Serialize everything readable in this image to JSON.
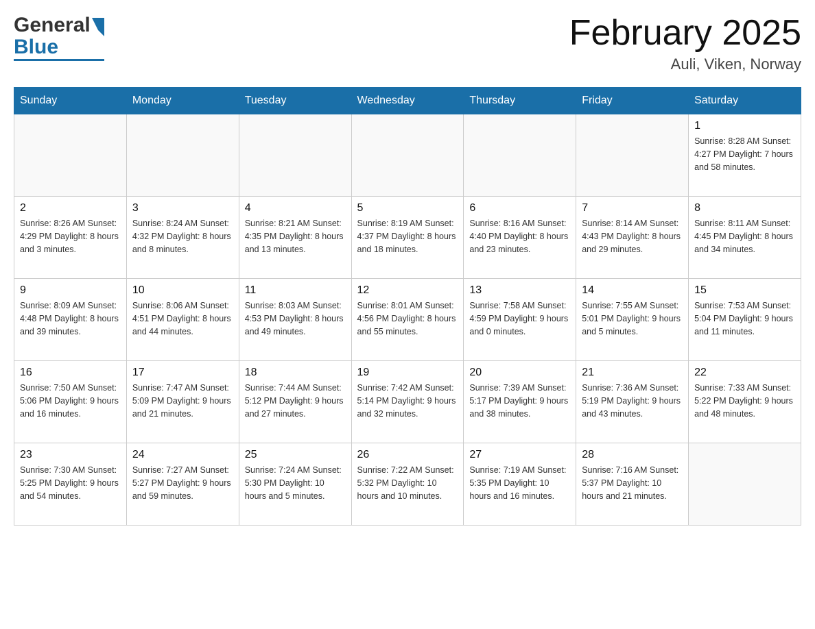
{
  "header": {
    "title": "February 2025",
    "subtitle": "Auli, Viken, Norway",
    "logo_general": "General",
    "logo_blue": "Blue"
  },
  "weekdays": [
    "Sunday",
    "Monday",
    "Tuesday",
    "Wednesday",
    "Thursday",
    "Friday",
    "Saturday"
  ],
  "weeks": [
    [
      {
        "day": "",
        "info": ""
      },
      {
        "day": "",
        "info": ""
      },
      {
        "day": "",
        "info": ""
      },
      {
        "day": "",
        "info": ""
      },
      {
        "day": "",
        "info": ""
      },
      {
        "day": "",
        "info": ""
      },
      {
        "day": "1",
        "info": "Sunrise: 8:28 AM\nSunset: 4:27 PM\nDaylight: 7 hours\nand 58 minutes."
      }
    ],
    [
      {
        "day": "2",
        "info": "Sunrise: 8:26 AM\nSunset: 4:29 PM\nDaylight: 8 hours\nand 3 minutes."
      },
      {
        "day": "3",
        "info": "Sunrise: 8:24 AM\nSunset: 4:32 PM\nDaylight: 8 hours\nand 8 minutes."
      },
      {
        "day": "4",
        "info": "Sunrise: 8:21 AM\nSunset: 4:35 PM\nDaylight: 8 hours\nand 13 minutes."
      },
      {
        "day": "5",
        "info": "Sunrise: 8:19 AM\nSunset: 4:37 PM\nDaylight: 8 hours\nand 18 minutes."
      },
      {
        "day": "6",
        "info": "Sunrise: 8:16 AM\nSunset: 4:40 PM\nDaylight: 8 hours\nand 23 minutes."
      },
      {
        "day": "7",
        "info": "Sunrise: 8:14 AM\nSunset: 4:43 PM\nDaylight: 8 hours\nand 29 minutes."
      },
      {
        "day": "8",
        "info": "Sunrise: 8:11 AM\nSunset: 4:45 PM\nDaylight: 8 hours\nand 34 minutes."
      }
    ],
    [
      {
        "day": "9",
        "info": "Sunrise: 8:09 AM\nSunset: 4:48 PM\nDaylight: 8 hours\nand 39 minutes."
      },
      {
        "day": "10",
        "info": "Sunrise: 8:06 AM\nSunset: 4:51 PM\nDaylight: 8 hours\nand 44 minutes."
      },
      {
        "day": "11",
        "info": "Sunrise: 8:03 AM\nSunset: 4:53 PM\nDaylight: 8 hours\nand 49 minutes."
      },
      {
        "day": "12",
        "info": "Sunrise: 8:01 AM\nSunset: 4:56 PM\nDaylight: 8 hours\nand 55 minutes."
      },
      {
        "day": "13",
        "info": "Sunrise: 7:58 AM\nSunset: 4:59 PM\nDaylight: 9 hours\nand 0 minutes."
      },
      {
        "day": "14",
        "info": "Sunrise: 7:55 AM\nSunset: 5:01 PM\nDaylight: 9 hours\nand 5 minutes."
      },
      {
        "day": "15",
        "info": "Sunrise: 7:53 AM\nSunset: 5:04 PM\nDaylight: 9 hours\nand 11 minutes."
      }
    ],
    [
      {
        "day": "16",
        "info": "Sunrise: 7:50 AM\nSunset: 5:06 PM\nDaylight: 9 hours\nand 16 minutes."
      },
      {
        "day": "17",
        "info": "Sunrise: 7:47 AM\nSunset: 5:09 PM\nDaylight: 9 hours\nand 21 minutes."
      },
      {
        "day": "18",
        "info": "Sunrise: 7:44 AM\nSunset: 5:12 PM\nDaylight: 9 hours\nand 27 minutes."
      },
      {
        "day": "19",
        "info": "Sunrise: 7:42 AM\nSunset: 5:14 PM\nDaylight: 9 hours\nand 32 minutes."
      },
      {
        "day": "20",
        "info": "Sunrise: 7:39 AM\nSunset: 5:17 PM\nDaylight: 9 hours\nand 38 minutes."
      },
      {
        "day": "21",
        "info": "Sunrise: 7:36 AM\nSunset: 5:19 PM\nDaylight: 9 hours\nand 43 minutes."
      },
      {
        "day": "22",
        "info": "Sunrise: 7:33 AM\nSunset: 5:22 PM\nDaylight: 9 hours\nand 48 minutes."
      }
    ],
    [
      {
        "day": "23",
        "info": "Sunrise: 7:30 AM\nSunset: 5:25 PM\nDaylight: 9 hours\nand 54 minutes."
      },
      {
        "day": "24",
        "info": "Sunrise: 7:27 AM\nSunset: 5:27 PM\nDaylight: 9 hours\nand 59 minutes."
      },
      {
        "day": "25",
        "info": "Sunrise: 7:24 AM\nSunset: 5:30 PM\nDaylight: 10 hours\nand 5 minutes."
      },
      {
        "day": "26",
        "info": "Sunrise: 7:22 AM\nSunset: 5:32 PM\nDaylight: 10 hours\nand 10 minutes."
      },
      {
        "day": "27",
        "info": "Sunrise: 7:19 AM\nSunset: 5:35 PM\nDaylight: 10 hours\nand 16 minutes."
      },
      {
        "day": "28",
        "info": "Sunrise: 7:16 AM\nSunset: 5:37 PM\nDaylight: 10 hours\nand 21 minutes."
      },
      {
        "day": "",
        "info": ""
      }
    ]
  ]
}
